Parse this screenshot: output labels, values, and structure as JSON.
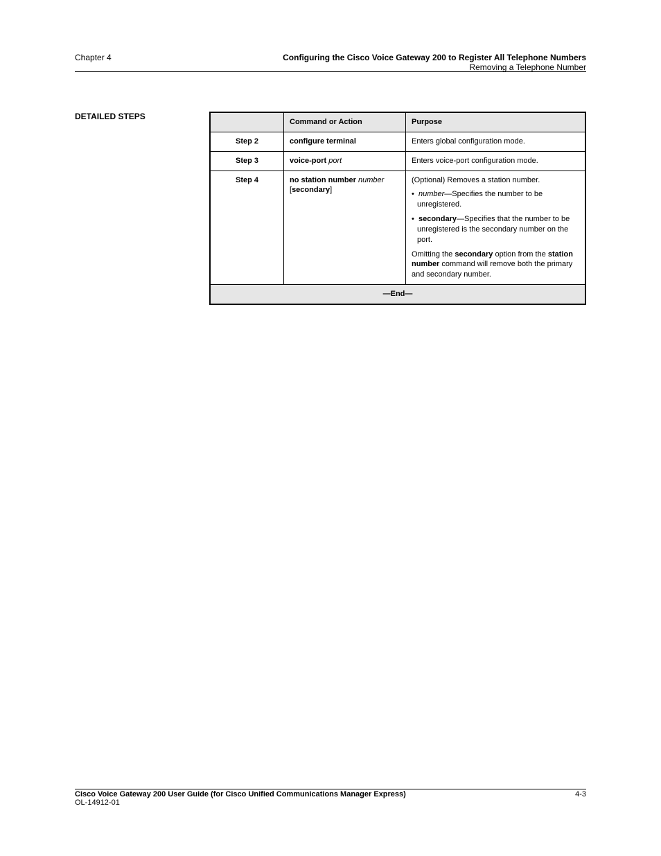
{
  "header": {
    "left": "Chapter 4",
    "right": "Configuring the Cisco Voice Gateway 200 to Register All Telephone Numbers",
    "subright": "Removing a Telephone Number"
  },
  "sidebar": {
    "heading": "DETAILED STEPS"
  },
  "table": {
    "col1": "",
    "col2": "Command or Action",
    "col3": "Purpose",
    "rows": [
      {
        "step": "Step 2",
        "cmd": "configure terminal",
        "purpose": "Enters global configuration mode."
      },
      {
        "step": "Step 3",
        "cmd": "voice-port port",
        "purpose": "Enters voice-port configuration mode."
      },
      {
        "step": "Step 4",
        "cmd": "no station number number [secondary]",
        "purpose_lines": [
          "(Optional) Removes a station number.",
          "• number—Specifies the number to be unregistered.",
          "• secondary—Specifies that the number to be unregistered is the secondary number on the port.",
          "Omitting the secondary option from the station number command will remove both the primary and secondary number."
        ]
      }
    ],
    "end": "—End—"
  },
  "footer": {
    "left_line1": "Cisco Voice Gateway 200 User Guide (for Cisco Unified Communications Manager Express)",
    "left_line2": "OL-14912-01",
    "right_page": "4-3"
  }
}
